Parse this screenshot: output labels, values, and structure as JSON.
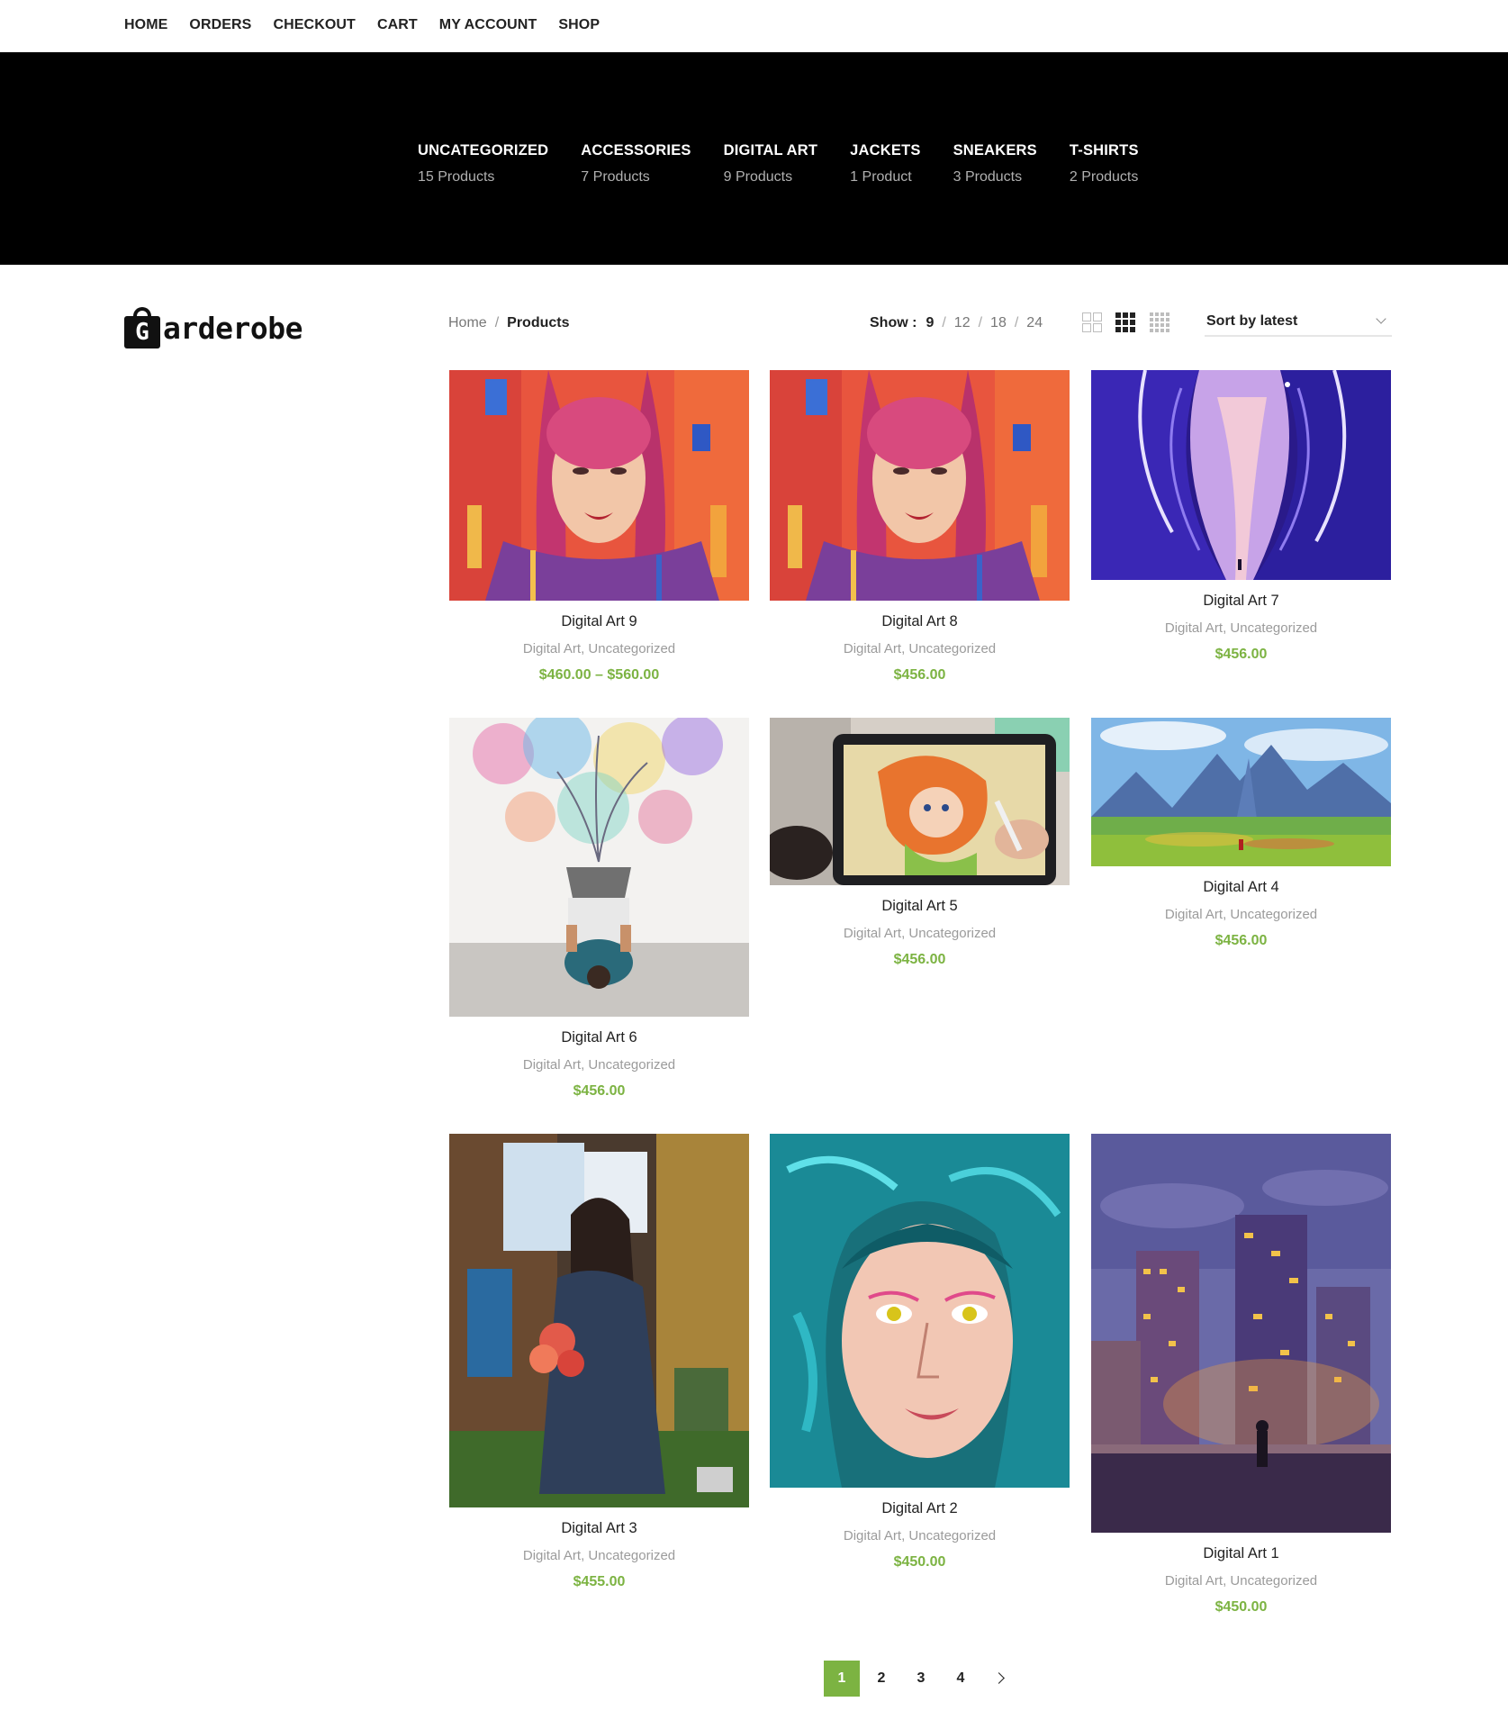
{
  "topnav": {
    "items": [
      "HOME",
      "ORDERS",
      "CHECKOUT",
      "CART",
      "MY ACCOUNT",
      "SHOP"
    ]
  },
  "categories": [
    {
      "name": "UNCATEGORIZED",
      "count": "15 Products"
    },
    {
      "name": "ACCESSORIES",
      "count": "7 Products"
    },
    {
      "name": "DIGITAL ART",
      "count": "9 Products"
    },
    {
      "name": "JACKETS",
      "count": "1 Product"
    },
    {
      "name": "SNEAKERS",
      "count": "3 Products"
    },
    {
      "name": "T-SHIRTS",
      "count": "2 Products"
    }
  ],
  "logo": {
    "letter": "G",
    "wordmark": "arderobe"
  },
  "breadcrumb": {
    "home": "Home",
    "separator": "/",
    "current": "Products"
  },
  "show_per_page": {
    "label": "Show :",
    "options": [
      "9",
      "12",
      "18",
      "24"
    ],
    "active": "9",
    "separator": "/"
  },
  "sort": {
    "selected": "Sort by latest"
  },
  "products": [
    {
      "name": "Digital Art 9",
      "categories": "Digital Art, Uncategorized",
      "price": "$460.00 – $560.00",
      "image": "painted-portrait-red-hair"
    },
    {
      "name": "Digital Art 8",
      "categories": "Digital Art, Uncategorized",
      "price": "$456.00",
      "image": "painted-portrait-red-hair"
    },
    {
      "name": "Digital Art 7",
      "categories": "Digital Art, Uncategorized",
      "price": "$456.00",
      "image": "purple-ice-cave"
    },
    {
      "name": "Digital Art 6",
      "categories": "Digital Art, Uncategorized",
      "price": "$456.00",
      "image": "person-at-laptop-colorful-burst"
    },
    {
      "name": "Digital Art 5",
      "categories": "Digital Art, Uncategorized",
      "price": "$456.00",
      "image": "drawing-on-tablet"
    },
    {
      "name": "Digital Art 4",
      "categories": "Digital Art, Uncategorized",
      "price": "$456.00",
      "image": "mountain-meadow-landscape"
    },
    {
      "name": "Digital Art 3",
      "categories": "Digital Art, Uncategorized",
      "price": "$455.00",
      "image": "woman-with-flowers-painting"
    },
    {
      "name": "Digital Art 2",
      "categories": "Digital Art, Uncategorized",
      "price": "$450.00",
      "image": "teal-hair-portrait"
    },
    {
      "name": "Digital Art 1",
      "categories": "Digital Art, Uncategorized",
      "price": "$450.00",
      "image": "city-at-dusk-rooftop"
    }
  ],
  "pagination": {
    "pages": [
      "1",
      "2",
      "3",
      "4"
    ],
    "active": "1"
  },
  "colors": {
    "accent": "#7cb342",
    "band": "#000000",
    "muted": "#9b9b9b"
  }
}
